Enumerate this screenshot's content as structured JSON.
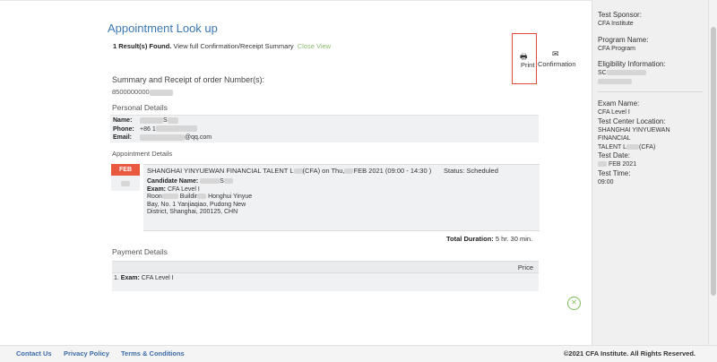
{
  "chrome": {
    "close_glyph": "×"
  },
  "page": {
    "title": "Appointment Look up",
    "results_count": "1 Result(s) Found.",
    "view_text": "View full Confirmation/Receipt Summary",
    "close_view_link": "Close View"
  },
  "actions": {
    "print_label": "Print",
    "print_icon": "print-icon",
    "confirmation_label": "Confirmation",
    "confirmation_icon": "envelope-icon"
  },
  "summary": {
    "heading": "Summary and Receipt of order Number(s):",
    "order_number": "8500000000"
  },
  "personal": {
    "heading": "Personal Details",
    "name_label": "Name:",
    "name_value": "S",
    "phone_label": "Phone:",
    "phone_value": "+86 1",
    "email_label": "Email:",
    "email_value": "@qq.com"
  },
  "appointment": {
    "heading": "Appointment Details",
    "month": "FEB",
    "summary_line": "SHANGHAI YINYUEWAN FINANCIAL TALENT L",
    "summary_line_mid": "(CFA) on Thu,",
    "summary_line_end": "FEB 2021 (09:00 - 14:30 )",
    "status": "Status: Scheduled",
    "candidate_label": "Candidate Name:",
    "candidate_value": "S",
    "exam_label": "Exam:",
    "exam_value": "CFA Level I",
    "address_1a": "Roon",
    "address_1b": "Buildir",
    "address_1c": "Honghui Yinyue",
    "address_2": "Bay, No. 1 Yanjiaqiao, Pudong New",
    "address_3": "District, Shanghai, 200125, CHN",
    "total_label": "Total Duration:",
    "total_value": "5 hr. 30 min."
  },
  "payment": {
    "heading": "Payment Details",
    "price_header": "Price",
    "row_prefix": "1.",
    "row_label": "Exam:",
    "row_value": "CFA Level I"
  },
  "sidebar": {
    "sponsor_label": "Test Sponsor:",
    "sponsor_value": "CFA Institute",
    "program_label": "Program Name:",
    "program_value": "CFA Program",
    "eligibility_label": "Eligibility Information:",
    "eligibility_value": "SC",
    "exam_label": "Exam Name:",
    "exam_value": "CFA Level I",
    "center_label": "Test Center Location:",
    "center_value_1": "SHANGHAI YINYUEWAN FINANCIAL",
    "center_value_2a": "TALENT L",
    "center_value_2b": "(CFA)",
    "date_label": "Test Date:",
    "date_value": "FEB 2021",
    "time_label": "Test Time:",
    "time_value": "09:00"
  },
  "footer": {
    "contact": "Contact Us",
    "privacy": "Privacy Policy",
    "terms": "Terms & Conditions",
    "copyright": "©2021 CFA Institute. All Rights Reserved."
  },
  "colors": {
    "title_blue": "#3b78b3",
    "link_green": "#8bbf6c",
    "highlight_red": "#e24a3c",
    "badge_orange": "#e8593f",
    "footer_link_blue": "#3b6aa8"
  }
}
